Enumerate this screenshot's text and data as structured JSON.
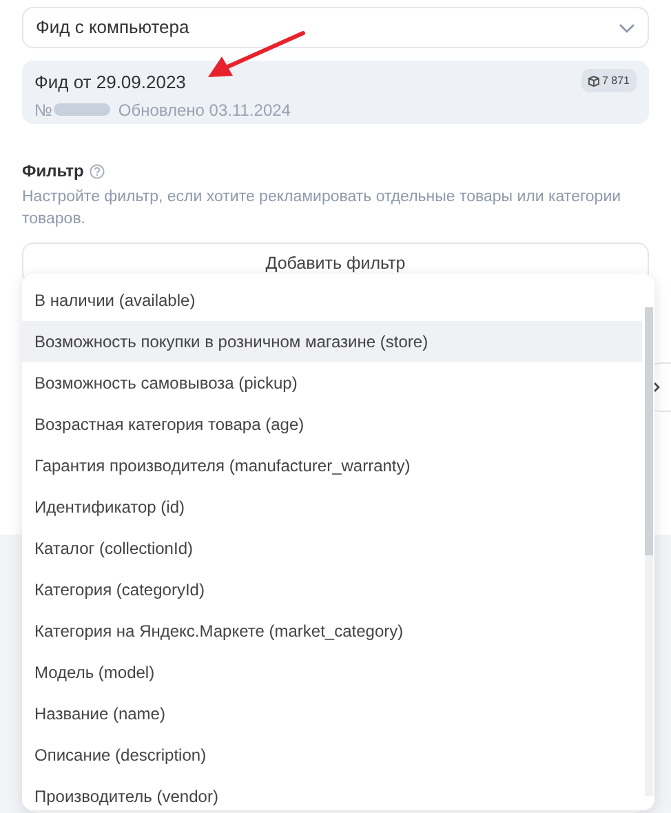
{
  "source_select": {
    "value": "Фид с компьютера"
  },
  "feed": {
    "title": "Фид от 29.09.2023",
    "number_prefix": "№",
    "updated": "Обновлено 03.11.2024",
    "count": "7 871"
  },
  "filter": {
    "title": "Фильтр",
    "description": "Настройте фильтр, если хотите рекламировать отдельные товары или категории товаров.",
    "add_button": "Добавить фильтр"
  },
  "dropdown": {
    "items": [
      {
        "label": "В наличии (available)",
        "selected": false
      },
      {
        "label": "Возможность покупки в розничном магазине (store)",
        "selected": true
      },
      {
        "label": "Возможность самовывоза (pickup)",
        "selected": false
      },
      {
        "label": "Возрастная категория товара (age)",
        "selected": false
      },
      {
        "label": "Гарантия производителя (manufacturer_warranty)",
        "selected": false
      },
      {
        "label": "Идентификатор (id)",
        "selected": false
      },
      {
        "label": "Каталог (collectionId)",
        "selected": false
      },
      {
        "label": "Категория (categoryId)",
        "selected": false
      },
      {
        "label": "Категория на Яндекс.Маркете (market_category)",
        "selected": false
      },
      {
        "label": "Модель (model)",
        "selected": false
      },
      {
        "label": "Название (name)",
        "selected": false
      },
      {
        "label": "Описание (description)",
        "selected": false
      },
      {
        "label": "Производитель (vendor)",
        "selected": false
      }
    ]
  }
}
